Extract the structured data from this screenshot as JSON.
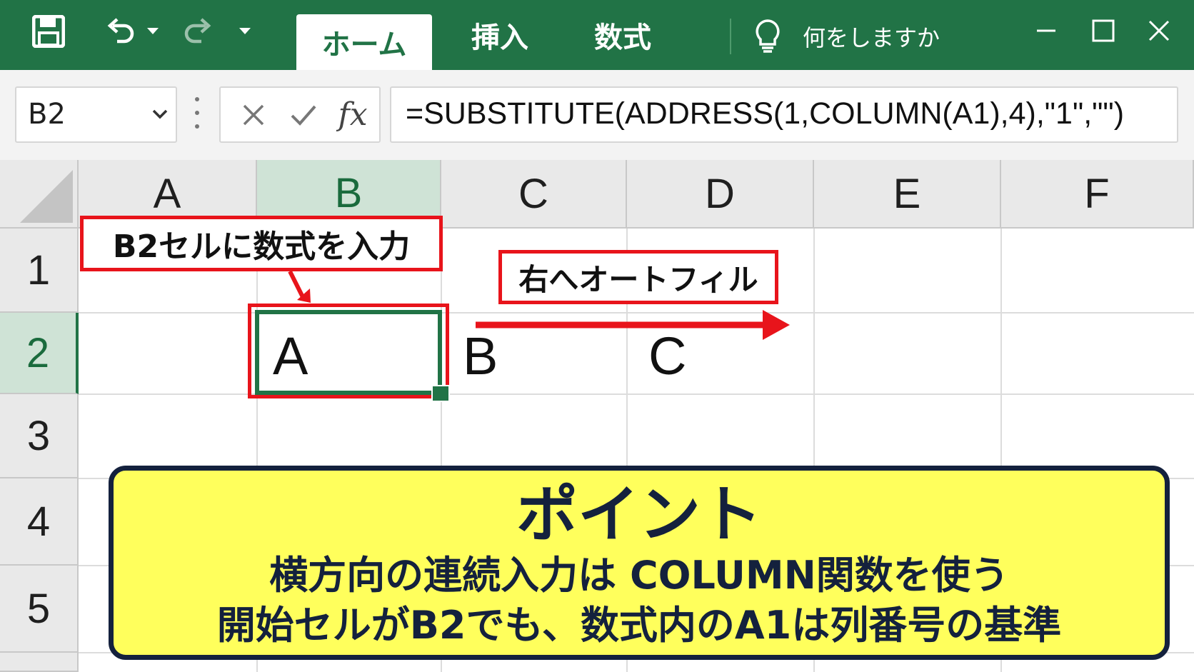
{
  "titlebar": {
    "tabs": [
      {
        "label": "ホーム",
        "active": true
      },
      {
        "label": "挿入",
        "active": false
      },
      {
        "label": "数式",
        "active": false
      }
    ],
    "tell_me": "何をしますか",
    "accent": "#217346"
  },
  "formula_bar": {
    "name_box": "B2",
    "fx_label": "fx",
    "formula": "=SUBSTITUTE(ADDRESS(1,COLUMN(A1),4),\"1\",\"\")"
  },
  "grid": {
    "columns": [
      "A",
      "B",
      "C",
      "D",
      "E",
      "F"
    ],
    "rows": [
      "1",
      "2",
      "3",
      "4",
      "5"
    ],
    "selected_cell": "B2",
    "cells": {
      "B2": "A",
      "C2": "B",
      "D2": "C"
    }
  },
  "annotations": {
    "callout_b2": "B2セルに数式を入力",
    "callout_fill": "右へオートフィル",
    "highlight_color": "#e8141b"
  },
  "point_box": {
    "title": "ポイント",
    "line1": "横方向の連続入力は COLUMN関数を使う",
    "line2": "開始セルがB2でも、数式内のA1は列番号の基準",
    "background": "#ffff5c"
  }
}
